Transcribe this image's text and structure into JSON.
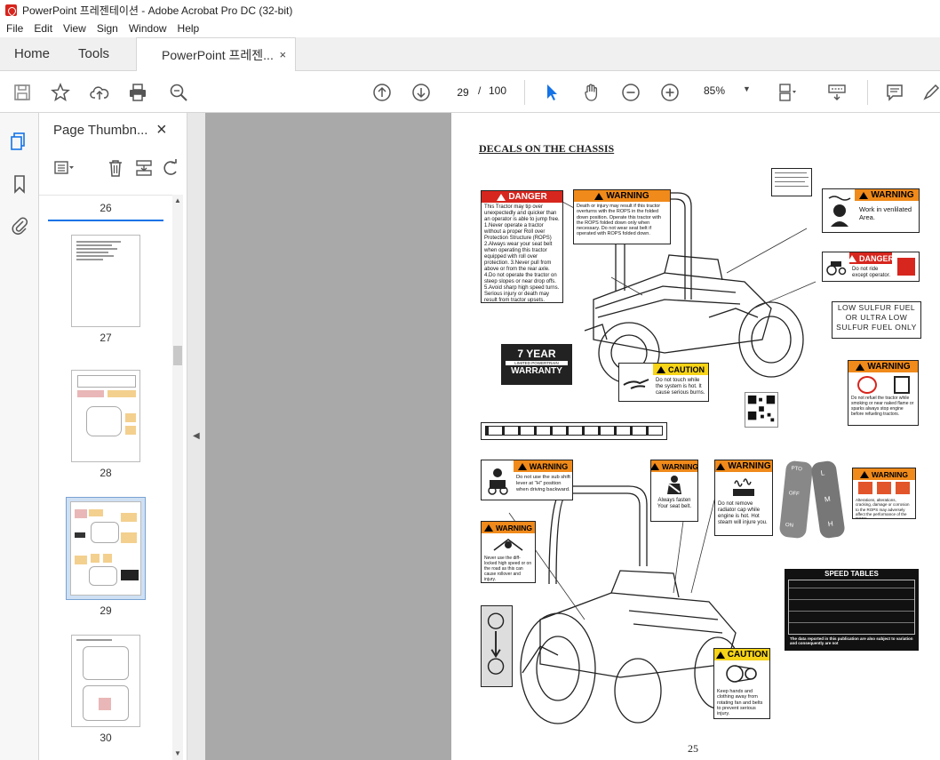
{
  "window": {
    "title": "PowerPoint 프레젠테이션 - Adobe Acrobat Pro DC (32-bit)"
  },
  "menu": [
    "File",
    "Edit",
    "View",
    "Sign",
    "Window",
    "Help"
  ],
  "tabs": {
    "home": "Home",
    "tools": "Tools",
    "document": "PowerPoint 프레젠...",
    "close": "×"
  },
  "toolbar": {
    "current_page": "29",
    "page_separator": "/",
    "total_pages": "100",
    "zoom": "85%"
  },
  "thumbnails": {
    "header": "Page Thumbn...",
    "close": "×",
    "pages": [
      {
        "label": "26",
        "selected": false
      },
      {
        "label": "27",
        "selected": false
      },
      {
        "label": "28",
        "selected": false
      },
      {
        "label": "29",
        "selected": true
      },
      {
        "label": "30",
        "selected": false
      }
    ]
  },
  "document": {
    "heading": "DECALS ON THE CHASSIS",
    "page_number": "25",
    "decals": {
      "danger_main": {
        "header": "DANGER",
        "text": "This Tractor may tip over unexpectedly and quicker than an operator is able to jump free. 1.Never operate a tractor without a proper Roll over Protection Structure (ROPS) 2.Always wear your seat belt when operating this tractor equipped with roll over protection. 3.Never pull from above or from the rear axle. 4.Do not operate the tractor on steep slopes or near drop offs. 5.Avoid sharp high speed turns. Serious injury or death may result from tractor upsets."
      },
      "warning_rops": {
        "header": "WARNING",
        "text": "Death or injury may result if this tractor overturns with the ROPS in the folded down position. Operate this tractor with the ROPS folded down only when necessary. Do not wear seat belt if operated with ROPS folded down."
      },
      "warning_vent": {
        "header": "WARNING",
        "text": "Work in venlilated Area."
      },
      "danger_ride": {
        "header": "DANGER",
        "text": "Do not ride except operator."
      },
      "fuel": {
        "line1": "LOW SULFUR FUEL",
        "line2": "OR ULTRA LOW",
        "line3": "SULFUR FUEL ONLY"
      },
      "warranty": {
        "line1": "7 YEAR",
        "line2": "LIMITED POWERTRAIN",
        "line3": "WARRANTY"
      },
      "caution_hot": {
        "header": "CAUTION",
        "text": "Do not touch while the system is hot. It cause serious burns."
      },
      "warning_refuel": {
        "header": "WARNING",
        "text": "Do not refuel the tractor while smoking or near naked flame or sparks always stop engine before refueling tractors."
      },
      "warning_shift": {
        "header": "WARNING",
        "text": "Do not use the sub shift lever at \"H\" position when driving backward."
      },
      "warning_seatbelt": {
        "header": "WARNING",
        "text": "Always fasten Your seat belt."
      },
      "warning_radiator": {
        "header": "WARNING",
        "text": "Do not remove radiator cap while engine is hot. Hot steam will injure you."
      },
      "warning_rops2": {
        "header": "WARNING",
        "text": "Alterations, alterations, cracking, damage or corrosion to the ROPS may adversely affect the performance of the ROPS."
      },
      "warning_diff": {
        "header": "WARNING",
        "text": "Never use the diff-locked high speed or on the road as this can cause rollover and injury."
      },
      "caution_fan": {
        "header": "CAUTION",
        "text": "Keep hands and clothing away from rotating fan and belts to prevent serious injury."
      },
      "speed_tables": {
        "header": "SPEED TABLES",
        "footer": "The data reported in this publication are also subject to variation and consequently are not"
      },
      "range_lever": {
        "top": "PTO",
        "mid": "OFF",
        "bot": "ON"
      },
      "shift_lever": {
        "top": "L",
        "mid": "M",
        "bot": "H"
      }
    }
  }
}
